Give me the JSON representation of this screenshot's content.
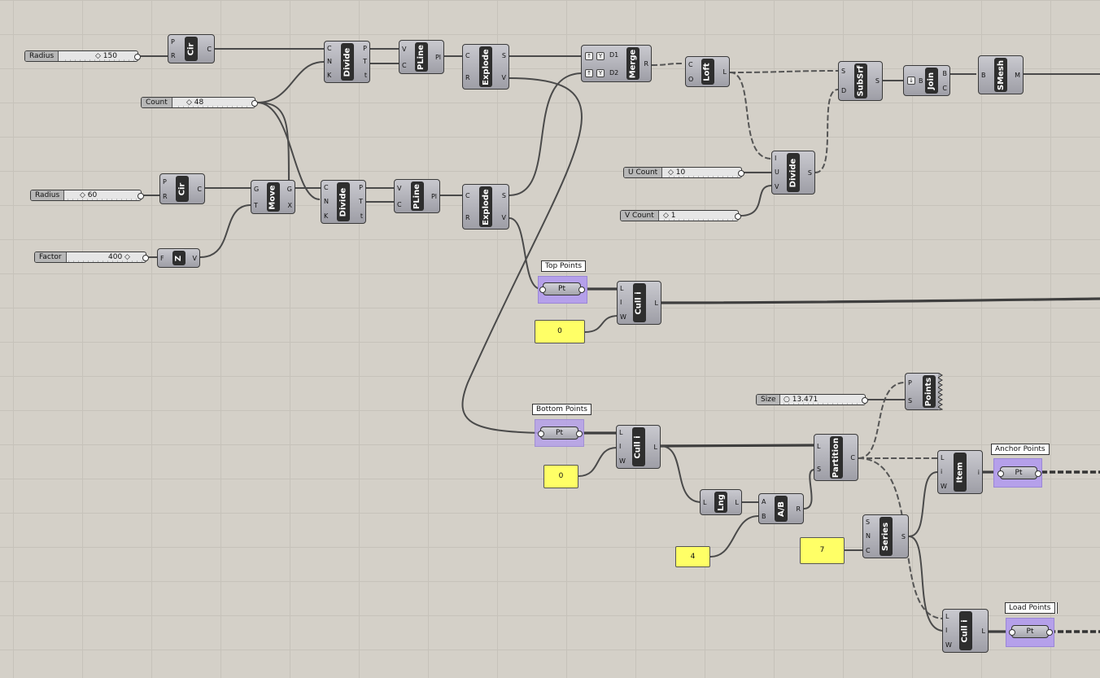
{
  "sliders": {
    "radius1": {
      "label": "Radius",
      "value": "150"
    },
    "count": {
      "label": "Count",
      "value": "48"
    },
    "radius2": {
      "label": "Radius",
      "value": "60"
    },
    "factor": {
      "label": "Factor",
      "value": "400"
    },
    "ucount": {
      "label": "U Count",
      "value": "10"
    },
    "vcount": {
      "label": "V Count",
      "value": "1"
    },
    "size": {
      "label": "Size",
      "value": "13.471"
    }
  },
  "panels": {
    "p0a": "0",
    "p0b": "0",
    "p4": "4",
    "p7": "7"
  },
  "groups": {
    "top": "Top Points",
    "bottom": "Bottom Points",
    "anchor": "Anchor Points",
    "load": "Load Points",
    "pt_label": "Pt"
  },
  "components": {
    "cir1": {
      "name": "Cir",
      "inputs": [
        "P",
        "R"
      ],
      "outputs": [
        "C"
      ]
    },
    "cir2": {
      "name": "Cir",
      "inputs": [
        "P",
        "R"
      ],
      "outputs": [
        "C"
      ]
    },
    "z": {
      "name": "Z",
      "inputs": [
        "F"
      ],
      "outputs": [
        "V"
      ]
    },
    "move": {
      "name": "Move",
      "inputs": [
        "G",
        "T"
      ],
      "outputs": [
        "G",
        "X"
      ]
    },
    "divide1": {
      "name": "Divide",
      "inputs": [
        "C",
        "N",
        "K"
      ],
      "outputs": [
        "P",
        "T",
        "t"
      ]
    },
    "divide2": {
      "name": "Divide",
      "inputs": [
        "C",
        "N",
        "K"
      ],
      "outputs": [
        "P",
        "T",
        "t"
      ]
    },
    "pline1": {
      "name": "PLine",
      "inputs": [
        "V",
        "C"
      ],
      "outputs": [
        "Pl"
      ]
    },
    "pline2": {
      "name": "PLine",
      "inputs": [
        "V",
        "C"
      ],
      "outputs": [
        "Pl"
      ]
    },
    "explode1": {
      "name": "Explode",
      "inputs": [
        "C",
        "R"
      ],
      "outputs": [
        "S",
        "V"
      ]
    },
    "explode2": {
      "name": "Explode",
      "inputs": [
        "C",
        "R"
      ],
      "outputs": [
        "S",
        "V"
      ]
    },
    "merge": {
      "name": "Merge",
      "inputs": [
        "D1",
        "D2"
      ],
      "outputs": [
        "R"
      ]
    },
    "loft": {
      "name": "Loft",
      "inputs": [
        "C",
        "O"
      ],
      "outputs": [
        "L"
      ]
    },
    "subsrf": {
      "name": "SubSrf",
      "inputs": [
        "S",
        "D"
      ],
      "outputs": [
        "S"
      ]
    },
    "join": {
      "name": "Join",
      "inputs": [
        "B"
      ],
      "outputs": [
        "B",
        "C"
      ]
    },
    "smesh": {
      "name": "SMesh",
      "inputs": [
        "B"
      ],
      "outputs": [
        "M"
      ]
    },
    "divide3": {
      "name": "Divide",
      "inputs": [
        "I",
        "U",
        "V"
      ],
      "outputs": [
        "S"
      ]
    },
    "cull1": {
      "name": "Cull i",
      "inputs": [
        "L",
        "I",
        "W"
      ],
      "outputs": [
        "L"
      ]
    },
    "cull2": {
      "name": "Cull i",
      "inputs": [
        "L",
        "I",
        "W"
      ],
      "outputs": [
        "L"
      ]
    },
    "points": {
      "name": "Points",
      "inputs": [
        "P",
        "S"
      ],
      "outputs": []
    },
    "partition": {
      "name": "Partition",
      "inputs": [
        "L",
        "S"
      ],
      "outputs": [
        "C"
      ]
    },
    "lng": {
      "name": "Lng",
      "inputs": [
        "L"
      ],
      "outputs": [
        "L"
      ]
    },
    "ab": {
      "name": "A/B",
      "inputs": [
        "A",
        "B"
      ],
      "outputs": [
        "R"
      ]
    },
    "item": {
      "name": "Item",
      "inputs": [
        "L",
        "i",
        "W"
      ],
      "outputs": [
        "i"
      ]
    },
    "series": {
      "name": "Series",
      "inputs": [
        "S",
        "N",
        "C"
      ],
      "outputs": [
        "S"
      ]
    },
    "cull3": {
      "name": "Cull i",
      "inputs": [
        "L",
        "I",
        "W"
      ],
      "outputs": [
        "L"
      ]
    }
  }
}
